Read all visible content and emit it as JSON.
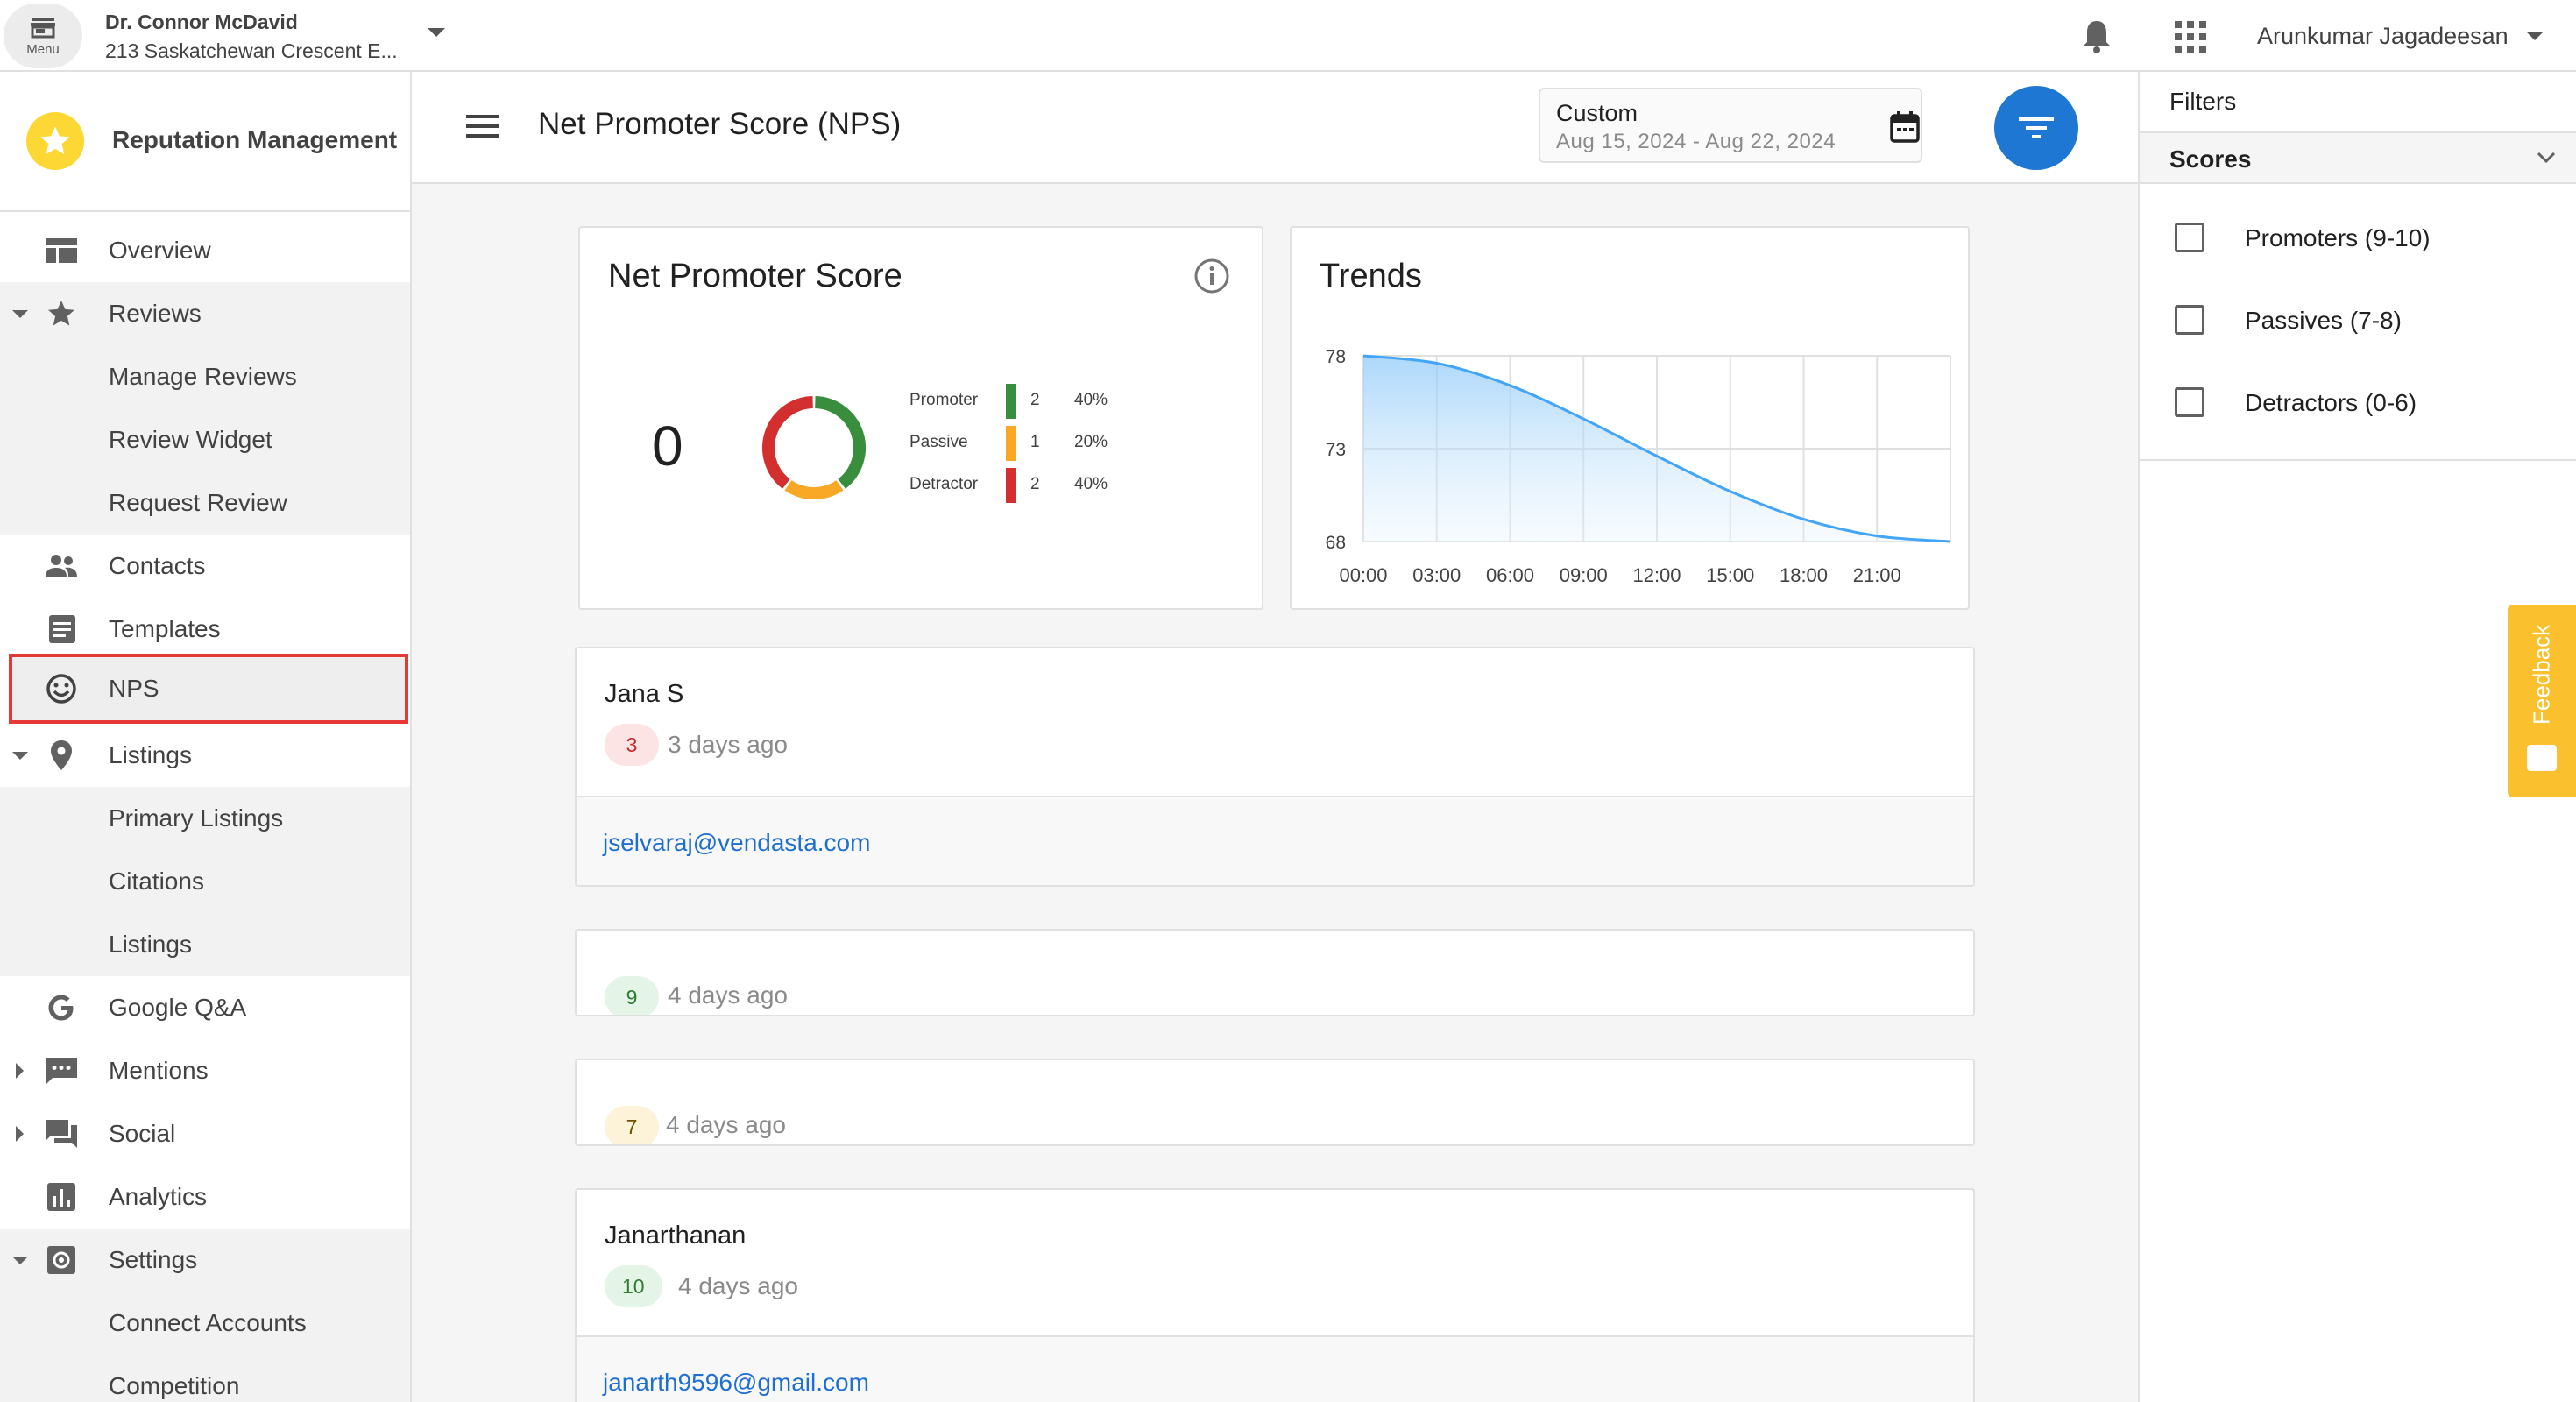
{
  "topbar": {
    "menu_label": "Menu",
    "business_name": "Dr. Connor McDavid",
    "business_address": "213 Saskatchewan Crescent E...",
    "user_name": "Arunkumar Jagadeesan"
  },
  "sidebar": {
    "product_name": "Reputation Management",
    "items": [
      {
        "label": "Overview",
        "icon": "dashboard-icon"
      },
      {
        "label": "Reviews",
        "icon": "star-icon"
      },
      {
        "label": "Manage Reviews"
      },
      {
        "label": "Review Widget"
      },
      {
        "label": "Request Review"
      },
      {
        "label": "Contacts",
        "icon": "people-icon"
      },
      {
        "label": "Templates",
        "icon": "document-icon"
      },
      {
        "label": "NPS",
        "icon": "smiley-icon"
      },
      {
        "label": "Listings",
        "icon": "location-pin-icon"
      },
      {
        "label": "Primary Listings"
      },
      {
        "label": "Citations"
      },
      {
        "label": "Listings"
      },
      {
        "label": "Google Q&A",
        "icon": "google-icon"
      },
      {
        "label": "Mentions",
        "icon": "chat-bubble-icon"
      },
      {
        "label": "Social",
        "icon": "forum-icon"
      },
      {
        "label": "Analytics",
        "icon": "bar-chart-icon"
      },
      {
        "label": "Settings",
        "icon": "gear-icon"
      },
      {
        "label": "Connect Accounts"
      },
      {
        "label": "Competition"
      }
    ]
  },
  "header": {
    "title": "Net Promoter Score (NPS)",
    "date_range_label": "Custom",
    "date_range_value": "Aug 15, 2024 - Aug 22, 2024"
  },
  "nps_card": {
    "title": "Net Promoter Score",
    "score": "0",
    "breakdown": [
      {
        "name": "Promoter",
        "count": "2",
        "percent": "40%",
        "value": 40,
        "color": "#388e3c"
      },
      {
        "name": "Passive",
        "count": "1",
        "percent": "20%",
        "value": 20,
        "color": "#f9a825"
      },
      {
        "name": "Detractor",
        "count": "2",
        "percent": "40%",
        "value": 40,
        "color": "#d32f2f"
      }
    ]
  },
  "chart_data": {
    "type": "area",
    "title": "Trends",
    "x": [
      "00:00",
      "03:00",
      "06:00",
      "09:00",
      "12:00",
      "15:00",
      "18:00",
      "21:00",
      "24:00"
    ],
    "x_tick_labels": [
      "00:00",
      "03:00",
      "06:00",
      "09:00",
      "12:00",
      "15:00",
      "18:00",
      "21:00"
    ],
    "series": [
      {
        "values": [
          78,
          77.6,
          76.4,
          74.6,
          72.6,
          70.7,
          69.2,
          68.3,
          68.0
        ]
      }
    ],
    "y_ticks": [
      "78",
      "73",
      "68"
    ],
    "ylim": [
      68,
      78
    ],
    "grid": true,
    "line_color": "#42a5f5"
  },
  "reviews": [
    {
      "name": "Jana S",
      "score": "3",
      "time_ago": "3 days ago",
      "email": "jselvaraj@vendasta.com"
    },
    {
      "name": "",
      "score": "9",
      "time_ago": "4 days ago",
      "email": ""
    },
    {
      "name": "",
      "score": "7",
      "time_ago": "4 days ago",
      "email": ""
    },
    {
      "name": "Janarthanan",
      "score": "10",
      "time_ago": "4 days ago",
      "email": "janarth9596@gmail.com"
    }
  ],
  "filters": {
    "title": "Filters",
    "section": "Scores",
    "options": [
      "Promoters (9-10)",
      "Passives (7-8)",
      "Detractors (0-6)"
    ]
  },
  "feedback_label": "Feedback"
}
